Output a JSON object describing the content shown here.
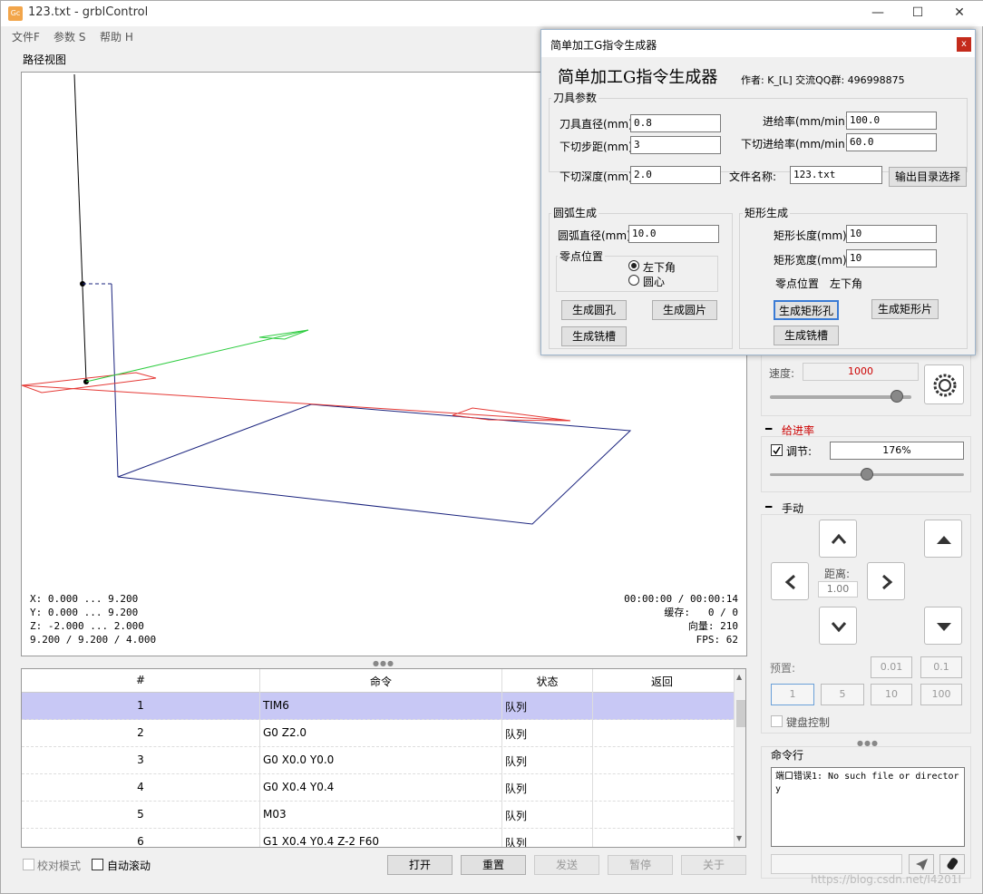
{
  "window": {
    "title": "123.txt - grblControl",
    "app_icon_text": "Gc",
    "controls": {
      "minimize": "—",
      "maximize": "☐",
      "close": "✕"
    }
  },
  "menu": [
    "文件F",
    "参数 S",
    "帮助 H"
  ],
  "view": {
    "label": "路径视图",
    "info_left": "X: 0.000 ... 9.200\nY: 0.000 ... 9.200\nZ: -2.000 ... 2.000\n9.200 / 9.200 / 4.000",
    "info_right": "00:00:00 / 00:00:14\n缓存:   0 / 0\n向量: 210\nFPS: 62"
  },
  "table": {
    "headers": [
      "#",
      "命令",
      "状态",
      "返回"
    ],
    "rows": [
      {
        "num": "1",
        "cmd": "TIM6",
        "status": "队列",
        "ret": ""
      },
      {
        "num": "2",
        "cmd": "G0 Z2.0",
        "status": "队列",
        "ret": ""
      },
      {
        "num": "3",
        "cmd": "G0 X0.0 Y0.0",
        "status": "队列",
        "ret": ""
      },
      {
        "num": "4",
        "cmd": "G0 X0.4 Y0.4",
        "status": "队列",
        "ret": ""
      },
      {
        "num": "5",
        "cmd": "M03",
        "status": "队列",
        "ret": ""
      },
      {
        "num": "6",
        "cmd": "G1 X0.4 Y0.4 Z-2 F60",
        "status": "队列",
        "ret": ""
      }
    ]
  },
  "bottom": {
    "check_mode": "校对模式",
    "auto_scroll": "自动滚动",
    "buttons": [
      "打开",
      "重置",
      "发送",
      "暂停",
      "关于"
    ]
  },
  "spindle": {
    "speed_label": "速度:",
    "speed_value": "1000",
    "slider_fraction": 0.9
  },
  "feed": {
    "title": "给进率",
    "adjust_label": "调节:",
    "adjust_value": "176%",
    "slider_fraction": 0.5
  },
  "jog": {
    "title": "手动",
    "distance_label": "距离:",
    "distance_value": "1.00",
    "preset_label": "预置:",
    "presets_row1": [
      "0.01",
      "0.1"
    ],
    "presets_row2": [
      "1",
      "5",
      "10",
      "100"
    ],
    "keyboard_control": "键盘控制"
  },
  "console": {
    "title": "命令行",
    "text": "端口错误1: No such file or directory"
  },
  "watermark": "https://blog.csdn.net/I4201I",
  "dialog": {
    "title": "简单加工G指令生成器",
    "heading": "简单加工G指令生成器",
    "author": "作者: K_[L]  交流QQ群: 496998875",
    "tool_group": "刀具参数",
    "tool_diameter_label": "刀具直径(mm)",
    "tool_diameter": "0.8",
    "step_down_label": "下切步距(mm)",
    "step_down": "3",
    "feed_rate_label": "进给率(mm/min)",
    "feed_rate": "100.0",
    "plunge_rate_label": "下切进给率(mm/min)",
    "plunge_rate": "60.0",
    "cut_depth_label": "下切深度(mm)",
    "cut_depth": "2.0",
    "file_name_label": "文件名称:",
    "file_name": "123.txt",
    "output_dir_button": "输出目录选择",
    "arc_group": "圆弧生成",
    "arc_diameter_label": "圆弧直径(mm)",
    "arc_diameter": "10.0",
    "zero_pos_label": "零点位置",
    "radio_corner": "左下角",
    "radio_center": "圆心",
    "btn_circle_hole": "生成圆孔",
    "btn_circle_piece": "生成圆片",
    "btn_slot_left": "生成铣槽",
    "rect_group": "矩形生成",
    "rect_length_label": "矩形长度(mm)",
    "rect_length": "10",
    "rect_width_label": "矩形宽度(mm)",
    "rect_width": "10",
    "rect_zero_label": "零点位置",
    "rect_zero_value": "左下角",
    "btn_rect_hole": "生成矩形孔",
    "btn_rect_piece": "生成矩形片",
    "btn_slot_right": "生成铣槽"
  }
}
